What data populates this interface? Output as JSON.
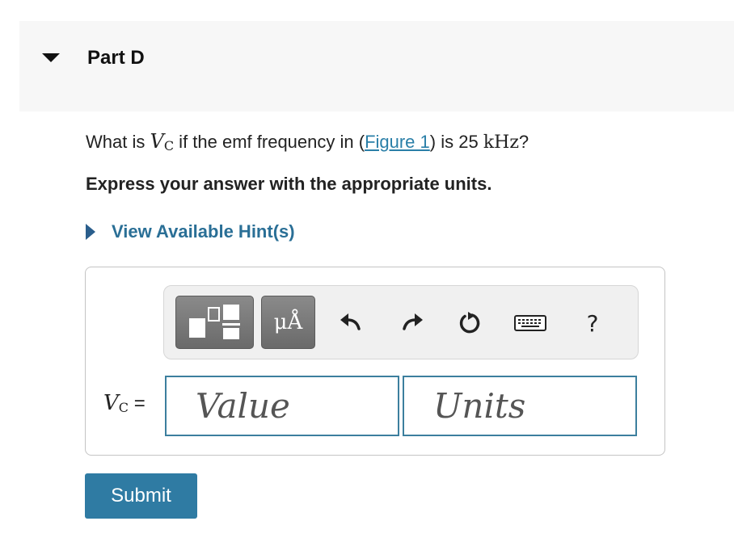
{
  "part": {
    "title": "Part D"
  },
  "question": {
    "prefix": "What is ",
    "var_symbol": "V",
    "var_subscript": "C",
    "middle": " if the emf frequency in (",
    "figure_link": "Figure 1",
    "after_link": ") is 25 ",
    "unit": "kHz",
    "suffix": "?"
  },
  "instruction": "Express your answer with the appropriate units.",
  "hint": {
    "label": "View Available Hint(s)"
  },
  "toolbar": {
    "units_button_label": "μÅ",
    "icons": [
      "templates-icon",
      "units-icon",
      "undo-icon",
      "redo-icon",
      "reset-icon",
      "keyboard-icon",
      "help-icon"
    ],
    "help_label": "?"
  },
  "answer": {
    "var_symbol": "V",
    "var_subscript": "C",
    "equals": " =",
    "value_placeholder": "Value",
    "units_placeholder": "Units"
  },
  "submit": {
    "label": "Submit"
  }
}
